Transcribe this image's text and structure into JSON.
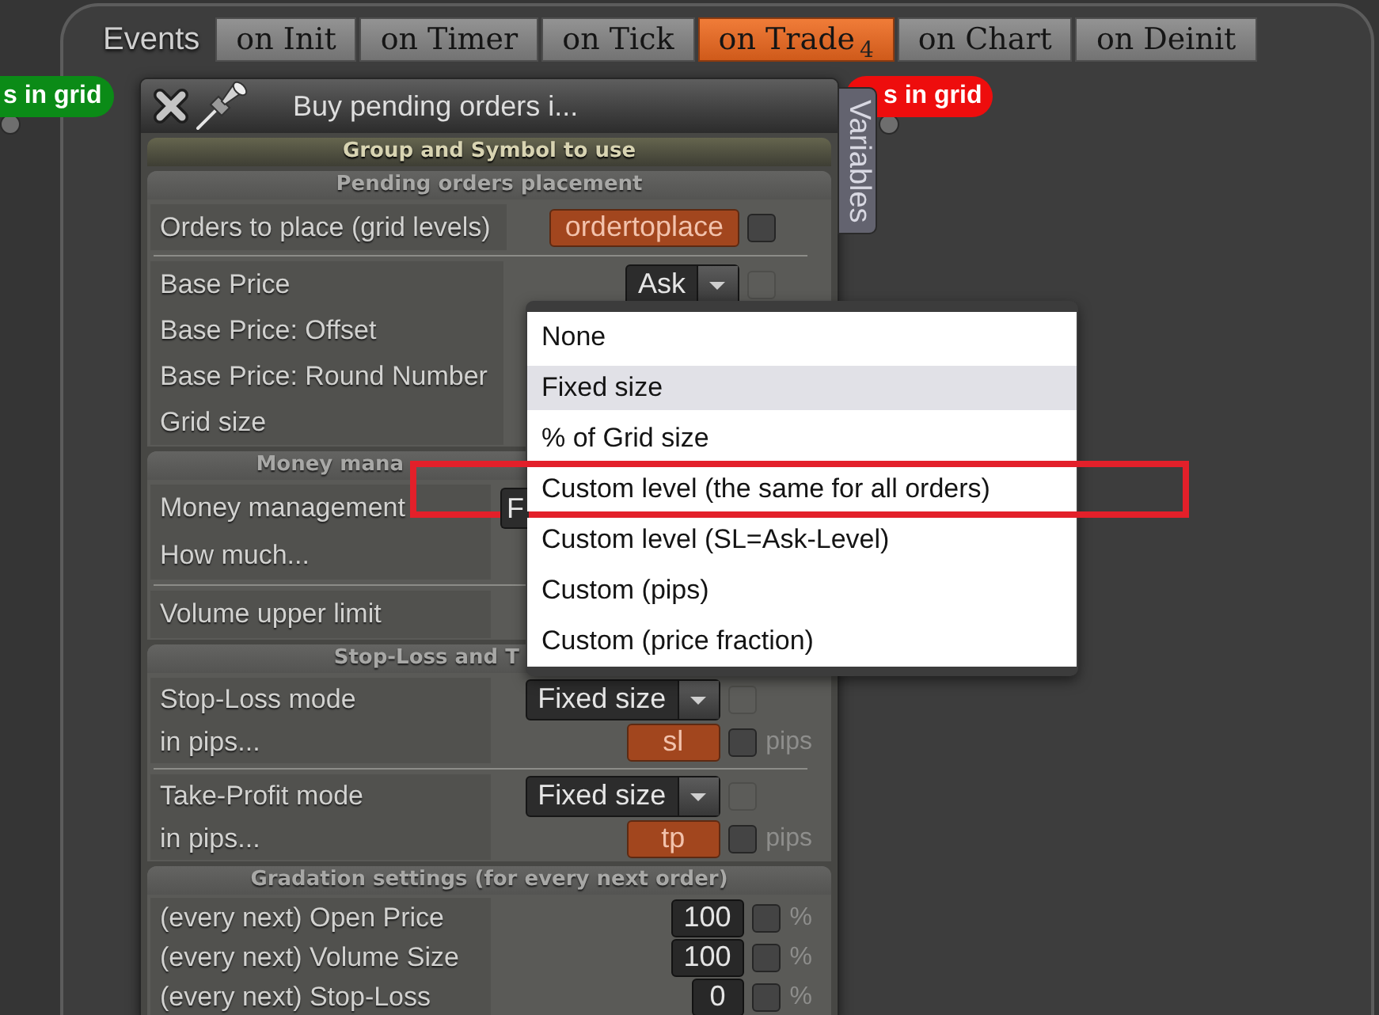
{
  "events_bar": {
    "label": "Events",
    "tabs": [
      {
        "label": "on Init",
        "selected": false
      },
      {
        "label": "on Timer",
        "selected": false
      },
      {
        "label": "on Tick",
        "selected": false
      },
      {
        "label": "on Trade",
        "selected": true,
        "badge": "4"
      },
      {
        "label": "on Chart",
        "selected": false
      },
      {
        "label": "on Deinit",
        "selected": false
      }
    ]
  },
  "nodes": [
    {
      "label": "s in grid",
      "color": "#0b8b17"
    },
    {
      "label": "s in grid",
      "color": "#ee0d0d"
    }
  ],
  "panel": {
    "title": "Buy pending orders i...",
    "side_tab": "Variables",
    "sections": [
      {
        "title": "Group and Symbol to use",
        "expanded": false
      },
      {
        "title": "Pending orders placement",
        "expanded": true,
        "groups": [
          {
            "rows": [
              {
                "label": "Orders to place (grid levels)",
                "control": {
                  "kind": "input",
                  "value": "ordertoplace"
                },
                "checkbox": {
                  "checked": false,
                  "disabled": false
                }
              }
            ]
          },
          {
            "rows": [
              {
                "label": "Base Price",
                "control": {
                  "kind": "select",
                  "value": "Ask",
                  "caret": true
                },
                "checkbox": {
                  "checked": false,
                  "disabled": true
                }
              },
              {
                "label": "Base Price: Offset"
              },
              {
                "label": "Base Price: Round Number"
              },
              {
                "label": "Grid size"
              }
            ]
          }
        ]
      },
      {
        "title": "Money mana",
        "expanded": true,
        "groups": [
          {
            "rows": [
              {
                "label": "Money management",
                "control": {
                  "kind": "select",
                  "value": "F",
                  "caret": false
                }
              },
              {
                "label": "How much..."
              }
            ]
          },
          {
            "rows": [
              {
                "label": "Volume upper limit"
              }
            ]
          }
        ]
      },
      {
        "title": "Stop-Loss and T",
        "expanded": true,
        "groups": [
          {
            "rows": [
              {
                "label": "Stop-Loss mode",
                "control": {
                  "kind": "select",
                  "value": "Fixed size",
                  "caret": true
                },
                "checkbox": {
                  "checked": false,
                  "disabled": true
                }
              },
              {
                "label": "in pips...",
                "control": {
                  "kind": "input",
                  "value": "sl"
                },
                "checkbox": {
                  "checked": false,
                  "disabled": false
                },
                "unit": "pips"
              }
            ]
          },
          {
            "rows": [
              {
                "label": "Take-Profit mode",
                "control": {
                  "kind": "select",
                  "value": "Fixed size",
                  "caret": true
                },
                "checkbox": {
                  "checked": false,
                  "disabled": true
                }
              },
              {
                "label": "in pips...",
                "control": {
                  "kind": "input",
                  "value": "tp"
                },
                "checkbox": {
                  "checked": false,
                  "disabled": false
                },
                "unit": "pips"
              }
            ]
          }
        ]
      },
      {
        "title": "Gradation settings (for every next order)",
        "expanded": true,
        "groups": [
          {
            "rows": [
              {
                "label": "(every next) Open Price",
                "control": {
                  "kind": "number",
                  "value": "100"
                },
                "checkbox": {
                  "checked": false,
                  "disabled": false
                },
                "unit": "%"
              },
              {
                "label": "(every next) Volume Size",
                "control": {
                  "kind": "number",
                  "value": "100"
                },
                "checkbox": {
                  "checked": false,
                  "disabled": false
                },
                "unit": "%"
              },
              {
                "label": "(every next) Stop-Loss",
                "control": {
                  "kind": "number",
                  "value": "0"
                },
                "checkbox": {
                  "checked": false,
                  "disabled": false
                },
                "unit": "%"
              }
            ]
          }
        ]
      }
    ]
  },
  "dropdown": {
    "options": [
      {
        "label": "None",
        "selected": false,
        "annotated": false
      },
      {
        "label": "Fixed size",
        "selected": true,
        "annotated": false
      },
      {
        "label": "% of Grid size",
        "selected": false,
        "annotated": false
      },
      {
        "label": "Custom level (the same for all orders)",
        "selected": false,
        "annotated": true
      },
      {
        "label": "Custom level (SL=Ask-Level)",
        "selected": false,
        "annotated": false
      },
      {
        "label": "Custom (pips)",
        "selected": false,
        "annotated": false
      },
      {
        "label": "Custom (price fraction)",
        "selected": false,
        "annotated": false
      }
    ]
  }
}
